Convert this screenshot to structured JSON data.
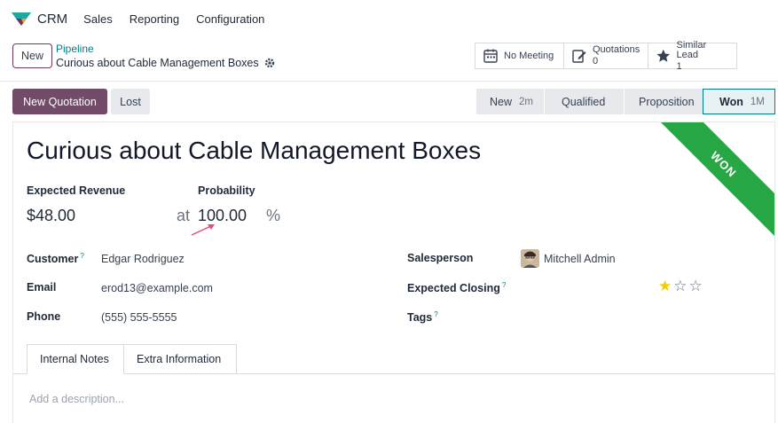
{
  "app": {
    "name": "CRM"
  },
  "nav": {
    "items": [
      "Sales",
      "Reporting",
      "Configuration"
    ]
  },
  "control_panel": {
    "new_button": "New",
    "breadcrumb_parent": "Pipeline",
    "breadcrumb_current": "Curious about Cable Management Boxes",
    "smart_buttons": [
      {
        "line1": "No Meeting",
        "line2": ""
      },
      {
        "line1": "Quotations",
        "line2": "0"
      },
      {
        "line1": "Similar Lead",
        "line2": "1"
      }
    ]
  },
  "actions": {
    "new_quotation": "New Quotation",
    "lost": "Lost"
  },
  "stages": [
    {
      "name": "New",
      "count": "2m"
    },
    {
      "name": "Qualified",
      "count": ""
    },
    {
      "name": "Proposition",
      "count": ""
    },
    {
      "name": "Won",
      "count": "1M"
    }
  ],
  "form": {
    "ribbon": "WON",
    "title": "Curious about Cable Management Boxes",
    "expected_revenue_label": "Expected Revenue",
    "expected_revenue": "$48.00",
    "at": "at",
    "probability_label": "Probability",
    "probability": "100.00",
    "percent": "%",
    "customer_label": "Customer",
    "customer": "Edgar Rodriguez",
    "email_label": "Email",
    "email": "erod13@example.com",
    "phone_label": "Phone",
    "phone": "(555) 555-5555",
    "salesperson_label": "Salesperson",
    "salesperson": "Mitchell Admin",
    "expected_closing_label": "Expected Closing",
    "tags_label": "Tags",
    "help_mark": "?",
    "priority_stars": 1,
    "priority_max": 3
  },
  "tabs": [
    "Internal Notes",
    "Extra Information"
  ],
  "notes_placeholder": "Add a description...",
  "colors": {
    "primary": "#714b67",
    "teal": "#017e84",
    "won_ribbon": "#28a745",
    "star": "#f3cc00",
    "arrow": "#e8497d"
  }
}
